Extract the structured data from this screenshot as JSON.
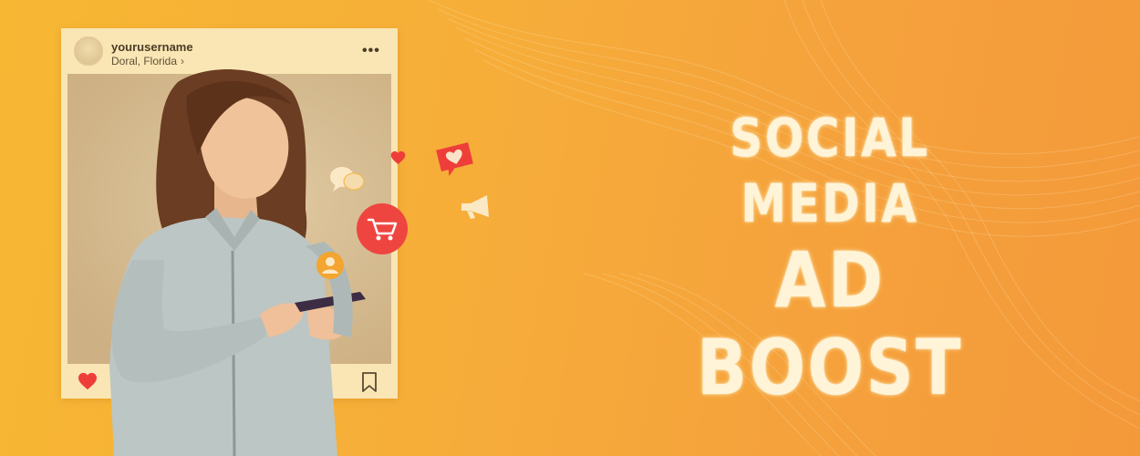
{
  "post": {
    "username": "yourusername",
    "location": "Doral, Florida",
    "location_chevron": "›",
    "more_icon": "•••"
  },
  "headline": {
    "line1": "SOCIAL MEDIA",
    "line2": "AD BOOST"
  },
  "icons": {
    "more": "more-horizontal-icon",
    "like": "heart-icon",
    "comment": "comment-icon",
    "share": "share-icon",
    "save": "bookmark-icon",
    "cart": "shopping-cart-icon",
    "chat": "chat-bubbles-icon",
    "megaphone": "megaphone-icon",
    "user": "user-icon"
  },
  "colors": {
    "background": "#f6ae39",
    "card": "#f9e6b4",
    "accent_red": "#f0443f",
    "headline": "#fff4d8"
  }
}
